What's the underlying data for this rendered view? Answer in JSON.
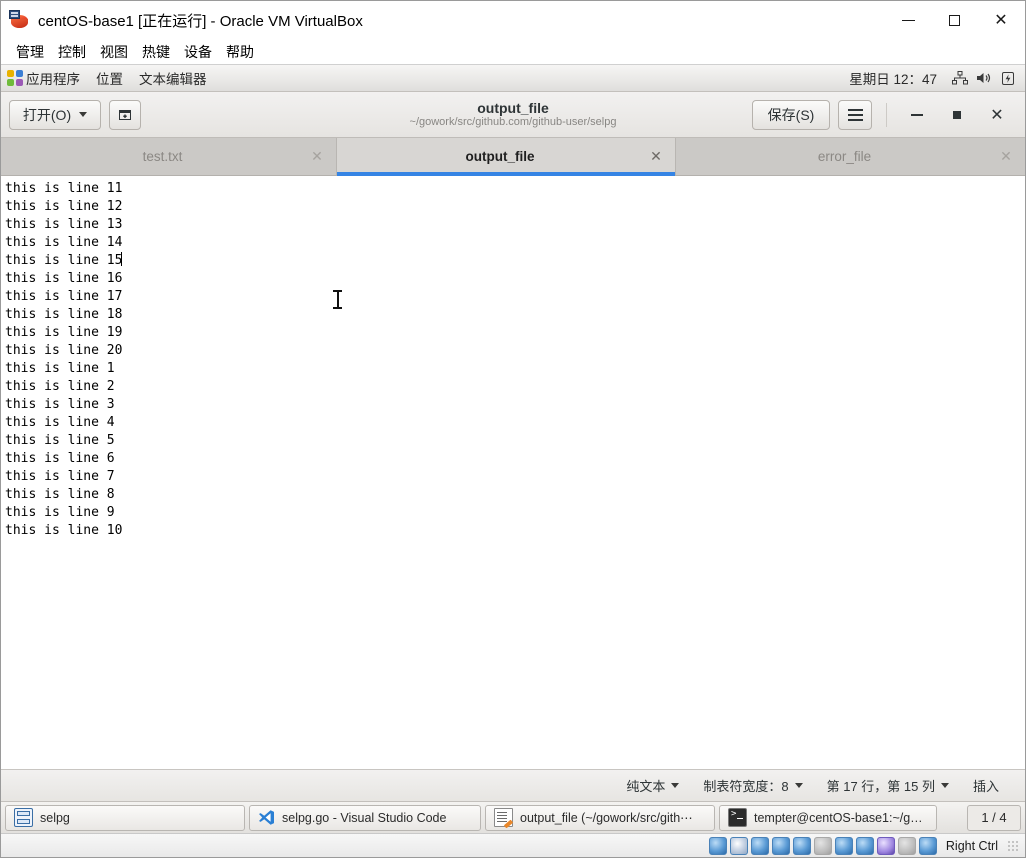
{
  "vbox": {
    "title": "centOS-base1 [正在运行] - Oracle VM VirtualBox",
    "icon": "virtualbox-logo-icon",
    "window_controls": {
      "minimize": "−",
      "maximize": "□",
      "close": "✕"
    },
    "menus": [
      "管理",
      "控制",
      "视图",
      "热键",
      "设备",
      "帮助"
    ],
    "statusbar": {
      "host_key_label": "Right Ctrl",
      "icons": [
        "hard-disk-icon",
        "optical-disk-icon",
        "floppy-icon",
        "network-icon",
        "usb-icon",
        "shared-folder-icon",
        "display-icon",
        "recording-icon",
        "cpu-icon",
        "mouse-icon",
        "keyboard-icon"
      ]
    }
  },
  "gnome_panel": {
    "apps_icon": "applications-icon",
    "items": [
      "应用程序",
      "位置",
      "文本编辑器"
    ],
    "clock": "星期日 12：47",
    "tray_icons": [
      "network-icon",
      "volume-icon",
      "battery-icon"
    ]
  },
  "gedit": {
    "header": {
      "open_label": "打开(O)",
      "open_icon": "chevron-down-icon",
      "new_doc_icon": "new-document-icon",
      "title": "output_file",
      "subtitle": "~/gowork/src/github.com/github-user/selpg",
      "save_label": "保存(S)",
      "menu_icon": "hamburger-menu-icon",
      "window_controls": {
        "minimize": "−",
        "maximize": "▪",
        "close": "✕"
      }
    },
    "tabs": [
      {
        "label": "test.txt",
        "active": false,
        "close_icon": "✕"
      },
      {
        "label": "output_file",
        "active": true,
        "close_icon": "✕"
      },
      {
        "label": "error_file",
        "active": false,
        "close_icon": "✕"
      }
    ],
    "document": {
      "lines": [
        "this is line 11",
        "this is line 12",
        "this is line 13",
        "this is line 14",
        "this is line 15",
        "this is line 16",
        "this is line 17",
        "this is line 18",
        "this is line 19",
        "this is line 20",
        "this is line 1",
        "this is line 2",
        "this is line 3",
        "this is line 4",
        "this is line 5",
        "this is line 6",
        "this is line 7",
        "this is line 8",
        "this is line 9",
        "this is line 10"
      ],
      "caret_line_index": 4
    },
    "statusbar": {
      "language": "纯文本",
      "tab_width": "制表符宽度：8",
      "position": "第 17 行，第 15 列",
      "insert_mode": "插入",
      "dropdown_icon": "chevron-down-icon"
    }
  },
  "taskbar": {
    "items": [
      {
        "label": "selpg",
        "icon": "file-manager-icon"
      },
      {
        "label": "selpg.go - Visual Studio Code",
        "icon": "vscode-icon"
      },
      {
        "label": "output_file (~/gowork/src/gith⋯",
        "icon": "gedit-icon"
      },
      {
        "label": "tempter@centOS-base1:~/gow⋯",
        "icon": "terminal-icon"
      }
    ],
    "pager": "1 / 4"
  }
}
